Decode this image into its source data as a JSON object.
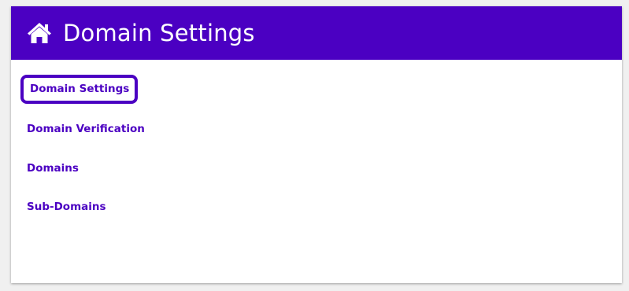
{
  "header": {
    "title": "Domain Settings",
    "icon": "home-icon"
  },
  "nav": {
    "items": [
      {
        "label": "Domain Settings",
        "active": true
      },
      {
        "label": "Domain Verification",
        "active": false
      },
      {
        "label": "Domains",
        "active": false
      },
      {
        "label": "Sub-Domains",
        "active": false
      }
    ]
  },
  "colors": {
    "brand": "#4b00c2",
    "header_text": "#ffffff",
    "page_background": "#f0f0f0",
    "card_background": "#ffffff"
  }
}
